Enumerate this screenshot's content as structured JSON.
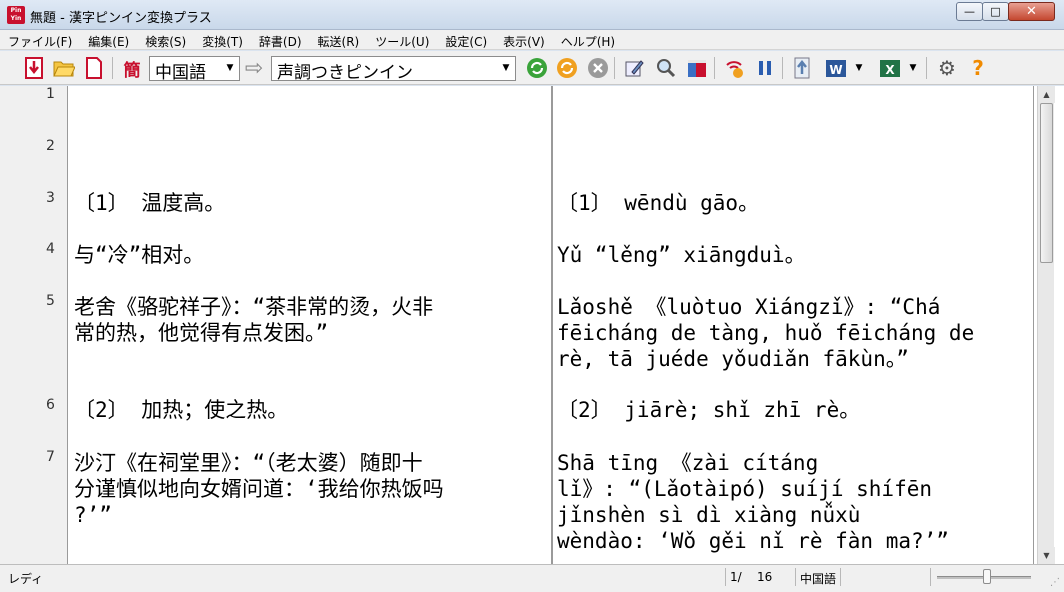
{
  "window": {
    "title": "無題 - 漢字ピンイン変換プラス",
    "icon_text": "Pin Yin",
    "minimize": "—",
    "maximize": "□",
    "close": "✕"
  },
  "menu": [
    "ファイル(F)",
    "編集(E)",
    "検索(S)",
    "変換(T)",
    "辞書(D)",
    "転送(R)",
    "ツール(U)",
    "設定(C)",
    "表示(V)",
    "ヘルプ(H)"
  ],
  "toolbar": {
    "simplified_label": "簡",
    "language_select": "中国語",
    "output_select": "声調つきピンイン"
  },
  "colors": {
    "accent_red": "#c8102e",
    "convert_green": "#3aa33a",
    "refresh_orange": "#f0a020"
  },
  "lines": [
    {
      "no": "1",
      "source": "",
      "pinyin": ""
    },
    {
      "no": "2",
      "source": "",
      "pinyin": ""
    },
    {
      "no": "3",
      "source": "〔1〕 温度高。",
      "pinyin": "〔1〕 wēndù gāo。"
    },
    {
      "no": "4",
      "source": "与“冷”相对。",
      "pinyin": "Yǔ “lěng” xiāngduì。"
    },
    {
      "no": "5",
      "source": "老舍《骆驼祥子》：“茶非常的烫，火非\n常的热，他觉得有点发困。”",
      "pinyin": "Lǎoshě 《luòtuo Xiángzǐ》: “Chá\nfēicháng de tàng, huǒ fēicháng de\nrè, tā juéde yǒudiǎn fākùn。”"
    },
    {
      "no": "6",
      "source": "〔2〕 加热；使之热。",
      "pinyin": "〔2〕 jiārè; shǐ zhī rè。"
    },
    {
      "no": "7",
      "source": "沙汀《在祠堂里》：“（老太婆）随即十\n分谨慎似地向女婿问道：‘我给你热饭吗\n?’”",
      "pinyin": "Shā tīng 《zài cítáng\nlǐ》: “(Lǎotàipó) suíjí shífēn\njǐnshèn sì dì xiàng nǚxù\nwèndào: ‘Wǒ gěi nǐ rè fàn ma?’”"
    }
  ],
  "status": {
    "mode": "レディ",
    "page_current": "1/",
    "page_total": "16",
    "language": "中国語"
  }
}
